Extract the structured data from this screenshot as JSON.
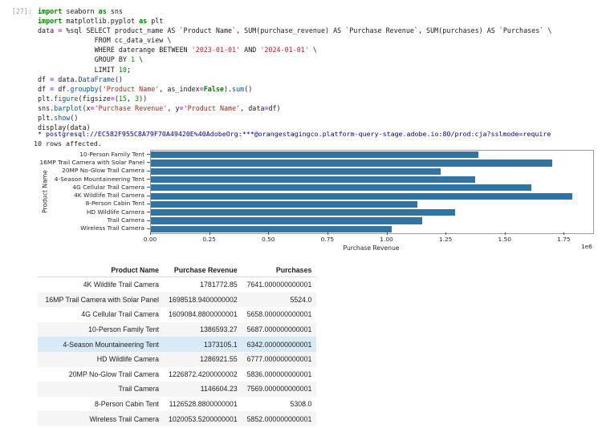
{
  "notebook": {
    "execution_label": "[27]:",
    "code_lines": [
      [
        {
          "t": "import",
          "c": "k"
        },
        {
          "t": " seaborn ",
          "c": "p"
        },
        {
          "t": "as",
          "c": "k"
        },
        {
          "t": " sns",
          "c": "p"
        }
      ],
      [
        {
          "t": "import",
          "c": "k"
        },
        {
          "t": " matplotlib.pyplot ",
          "c": "p"
        },
        {
          "t": "as",
          "c": "k"
        },
        {
          "t": " plt",
          "c": "p"
        }
      ],
      [
        {
          "t": "data ",
          "c": "p"
        },
        {
          "t": "=",
          "c": "o"
        },
        {
          "t": " %sql SELECT product_name AS `Product Name`, SUM(purchase_revenue) AS `Purchase Revenue`, SUM(purchases) AS `Purchases` \\",
          "c": "p"
        }
      ],
      [
        {
          "t": "              FROM cc_data_view \\",
          "c": "p"
        }
      ],
      [
        {
          "t": "              WHERE daterange BETWEEN ",
          "c": "p"
        },
        {
          "t": "'2023-01-01'",
          "c": "s"
        },
        {
          "t": " AND ",
          "c": "p"
        },
        {
          "t": "'2024-01-01'",
          "c": "s"
        },
        {
          "t": " \\",
          "c": "p"
        }
      ],
      [
        {
          "t": "              GROUP BY ",
          "c": "p"
        },
        {
          "t": "1",
          "c": "n"
        },
        {
          "t": " \\",
          "c": "p"
        }
      ],
      [
        {
          "t": "              LIMIT ",
          "c": "p"
        },
        {
          "t": "10",
          "c": "n"
        },
        {
          "t": ";",
          "c": "p"
        }
      ],
      [
        {
          "t": "df ",
          "c": "p"
        },
        {
          "t": "=",
          "c": "o"
        },
        {
          "t": " data.",
          "c": "p"
        },
        {
          "t": "DataFrame",
          "c": "f"
        },
        {
          "t": "()",
          "c": "p"
        }
      ],
      [
        {
          "t": "df ",
          "c": "p"
        },
        {
          "t": "=",
          "c": "o"
        },
        {
          "t": " df.",
          "c": "p"
        },
        {
          "t": "groupby",
          "c": "f"
        },
        {
          "t": "(",
          "c": "p"
        },
        {
          "t": "'Product Name'",
          "c": "s"
        },
        {
          "t": ", as_index",
          "c": "p"
        },
        {
          "t": "=",
          "c": "o"
        },
        {
          "t": "False",
          "c": "k"
        },
        {
          "t": ").",
          "c": "p"
        },
        {
          "t": "sum",
          "c": "f"
        },
        {
          "t": "()",
          "c": "p"
        }
      ],
      [
        {
          "t": "plt.",
          "c": "p"
        },
        {
          "t": "figure",
          "c": "f"
        },
        {
          "t": "(figsize",
          "c": "p"
        },
        {
          "t": "=",
          "c": "o"
        },
        {
          "t": "(",
          "c": "p"
        },
        {
          "t": "15",
          "c": "n"
        },
        {
          "t": ", ",
          "c": "p"
        },
        {
          "t": "3",
          "c": "n"
        },
        {
          "t": "))",
          "c": "p"
        }
      ],
      [
        {
          "t": "sns.",
          "c": "p"
        },
        {
          "t": "barplot",
          "c": "f"
        },
        {
          "t": "(x",
          "c": "p"
        },
        {
          "t": "=",
          "c": "o"
        },
        {
          "t": "'Purchase Revenue'",
          "c": "s"
        },
        {
          "t": ", y",
          "c": "p"
        },
        {
          "t": "=",
          "c": "o"
        },
        {
          "t": "'Product Name'",
          "c": "s"
        },
        {
          "t": ", data",
          "c": "p"
        },
        {
          "t": "=",
          "c": "o"
        },
        {
          "t": "df)",
          "c": "p"
        }
      ],
      [
        {
          "t": "plt.",
          "c": "p"
        },
        {
          "t": "show",
          "c": "f"
        },
        {
          "t": "()",
          "c": "p"
        }
      ],
      [
        {
          "t": "display(data)",
          "c": "p"
        }
      ]
    ],
    "output": {
      "connection_line": " * postgresql://EC582F955C8A79F70A49420E%40AdobeOrg:***@orangestagingco.platform-query-stage.adobe.io:80/prod:cja?sslmode=require",
      "rows_affected": "10 rows affected."
    }
  },
  "chart_data": {
    "type": "bar",
    "orientation": "horizontal",
    "title": "",
    "xlabel": "Purchase Revenue",
    "ylabel": "Product Name",
    "categories": [
      "10-Person Family Tent",
      "16MP Trail Camera with Solar Panel",
      "20MP No-Glow Trail Camera",
      "4-Season Mountaineering Tent",
      "4G Cellular Trail Camera",
      "4K Wildlife Trail Camera",
      "8-Person Cabin Tent",
      "HD Wildlife Camera",
      "Trail Camera",
      "Wireless Trail Camera"
    ],
    "values": [
      1386593.27,
      1698518.94,
      1226872.42,
      1373105.1,
      1609084.88,
      1781772.85,
      1126528.88,
      1286921.55,
      1146604.23,
      1020053.52
    ],
    "xlim": [
      0,
      1870861
    ],
    "xticks": [
      "0.00",
      "0.25",
      "0.50",
      "0.75",
      "1.00",
      "1.25",
      "1.50",
      "1.75"
    ],
    "xtick_step": 250000,
    "offset_label": "1e6",
    "grid": false,
    "legend_position": null,
    "bar_color": "#3274a1"
  },
  "table": {
    "columns": [
      "Product Name",
      "Purchase Revenue",
      "Purchases"
    ],
    "rows": [
      [
        "4K Wildlife Trail Camera",
        "1781772.85",
        "7641.000000000001"
      ],
      [
        "16MP Trail Camera with Solar Panel",
        "1698518.9400000002",
        "5524.0"
      ],
      [
        "4G Cellular Trail Camera",
        "1609084.8800000001",
        "5658.000000000001"
      ],
      [
        "10-Person Family Tent",
        "1386593.27",
        "5687.000000000001"
      ],
      [
        "4-Season Mountaineering Tent",
        "1373105.1",
        "6342.000000000001"
      ],
      [
        "HD Wildlife Camera",
        "1286921.55",
        "6777.000000000001"
      ],
      [
        "20MP No-Glow Trail Camera",
        "1226872.4200000002",
        "5836.000000000001"
      ],
      [
        "Trail Camera",
        "1146604.23",
        "7569.000000000001"
      ],
      [
        "8-Person Cabin Tent",
        "1126528.8800000001",
        "5308.0"
      ],
      [
        "Wireless Trail Camera",
        "1020053.5200000001",
        "5852.000000000001"
      ]
    ],
    "highlight_row_index": 4,
    "stripe_color": "#f5f5f5",
    "highlight_color": "#d9eaf7"
  },
  "colors": {
    "bar": "#3274a1",
    "keyword": "#008000",
    "operator": "#AA22FF",
    "string": "#BA2121",
    "number": "#008800",
    "function": "#0055aa",
    "connection_text": "#00008B",
    "prompt_text": "#9e9e9e"
  }
}
